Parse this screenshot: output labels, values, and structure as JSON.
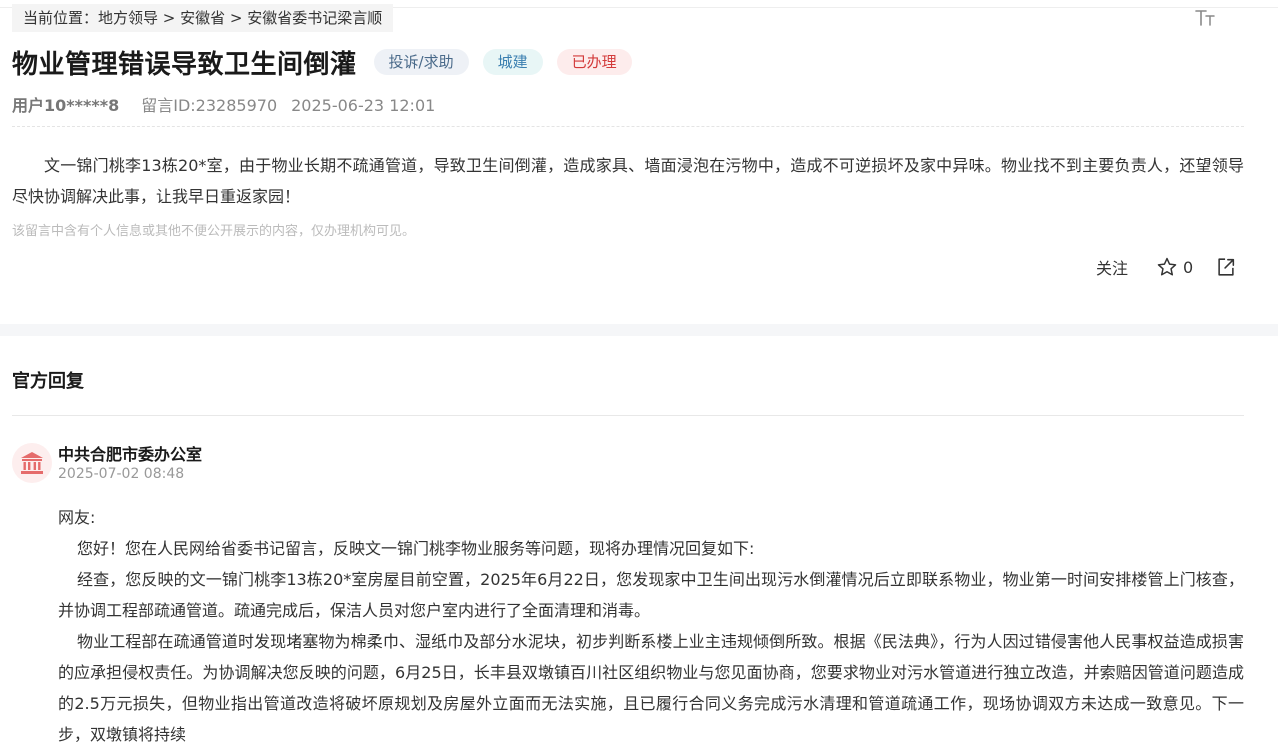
{
  "breadcrumb": {
    "prefix": "当前位置：",
    "level1": "地方领导",
    "sep": " > ",
    "level2": "安徽省",
    "level3": "安徽省委书记梁言顺"
  },
  "message": {
    "title": "物业管理错误导致卫生间倒灌",
    "tags": {
      "type": "投诉/求助",
      "field": "城建",
      "status": "已办理"
    },
    "user": "用户10*****8",
    "message_id": "留言ID:23285970",
    "datetime": "2025-06-23 12:01",
    "content": "文一锦门桃李13栋20*室，由于物业长期不疏通管道，导致卫生间倒灌，造成家具、墙面浸泡在污物中，造成不可逆损坏及家中异味。物业找不到主要负责人，还望领导尽快协调解决此事，让我早日重返家园！",
    "privacy_notice": "该留言中含有个人信息或其他不便公开展示的内容，仅办理机构可见。"
  },
  "actions": {
    "follow_label": "关注",
    "like_count": "0"
  },
  "official": {
    "section_title": "官方回复",
    "org_name": "中共合肥市委办公室",
    "reply_time": "2025-07-02 08:48",
    "paragraphs": [
      "网友:",
      "您好！您在人民网给省委书记留言，反映文一锦门桃李物业服务等问题，现将办理情况回复如下:",
      "经查，您反映的文一锦门桃李13栋20*室房屋目前空置，2025年6月22日，您发现家中卫生间出现污水倒灌情况后立即联系物业，物业第一时间安排楼管上门核查，并协调工程部疏通管道。疏通完成后，保洁人员对您户室内进行了全面清理和消毒。",
      "物业工程部在疏通管道时发现堵塞物为棉柔巾、湿纸巾及部分水泥块，初步判断系楼上业主违规倾倒所致。根据《民法典》，行为人因过错侵害他人民事权益造成损害的应承担侵权责任。为协调解决您反映的问题，6月25日，长丰县双墩镇百川社区组织物业与您见面协商，您要求物业对污水管道进行独立改造，并索赔因管道问题造成的2.5万元损失，但物业指出管道改造将破坏原规划及房屋外立面而无法实施，且已履行合同义务完成污水清理和管道疏通工作，现场协调双方未达成一致意见。下一步，双墩镇将持续"
    ]
  },
  "colors": {
    "tag_status": "#d33a3a",
    "tag_field": "#3a7fb0",
    "avatar_icon": "#e56b6b"
  }
}
